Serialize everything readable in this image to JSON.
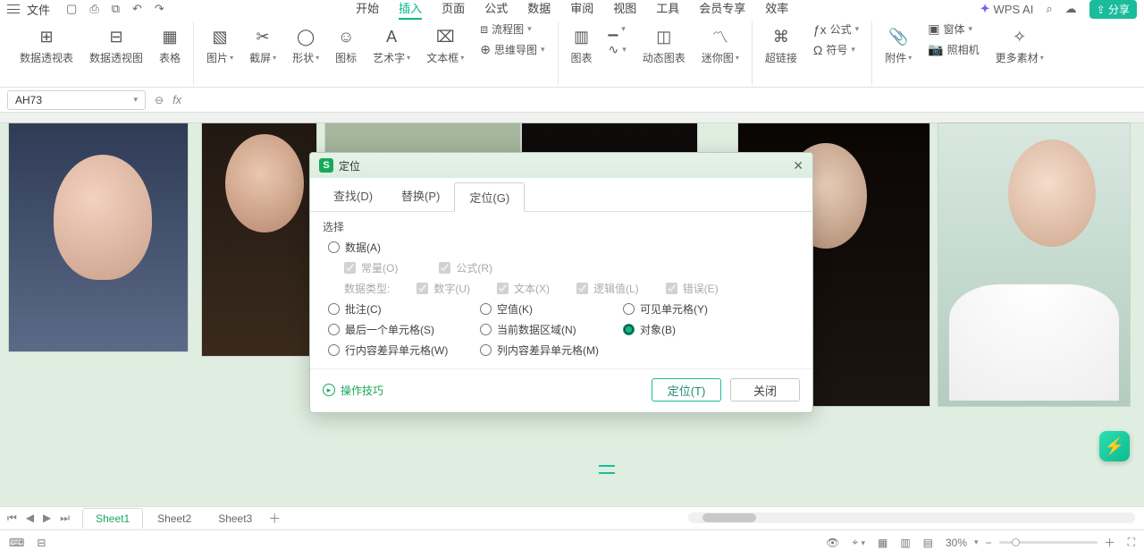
{
  "menubar": {
    "file": "文件",
    "tabs": [
      "开始",
      "插入",
      "页面",
      "公式",
      "数据",
      "审阅",
      "视图",
      "工具",
      "会员专享",
      "效率"
    ],
    "active_tab": 1,
    "ai": "WPS AI",
    "share": "分享"
  },
  "ribbon": {
    "g1": {
      "pivot_table": "数据透视表",
      "pivot_chart": "数据透视图",
      "table": "表格"
    },
    "g2": {
      "picture": "图片",
      "screenshot": "截屏",
      "shape": "形状",
      "icon": "图标",
      "wordart": "艺术字",
      "textbox": "文本框",
      "flow": "流程图",
      "mind": "思维导图"
    },
    "g3": {
      "chart": "图表",
      "spark": "迷你图",
      "dyn": "动态图表"
    },
    "g4": {
      "link": "超链接",
      "formula": "公式",
      "symbol": "符号"
    },
    "g5": {
      "attach": "附件",
      "camera": "照相机",
      "window": "窗体",
      "more": "更多素材"
    }
  },
  "namebox": "AH73",
  "dialog": {
    "title": "定位",
    "tabs": [
      "查找(D)",
      "替换(P)",
      "定位(G)"
    ],
    "active_tab": 2,
    "section": "选择",
    "data": "数据(A)",
    "const": "常量(O)",
    "formula": "公式(R)",
    "dtype": "数据类型:",
    "num": "数字(U)",
    "text": "文本(X)",
    "logic": "逻辑值(L)",
    "err": "错误(E)",
    "comment": "批注(C)",
    "blank": "空值(K)",
    "visible": "可见单元格(Y)",
    "last": "最后一个单元格(S)",
    "region": "当前数据区域(N)",
    "object": "对象(B)",
    "rowdiff": "行内容差异单元格(W)",
    "coldiff": "列内容差异单元格(M)",
    "tips": "操作技巧",
    "btn_go": "定位(T)",
    "btn_close": "关闭"
  },
  "sheets": [
    "Sheet1",
    "Sheet2",
    "Sheet3"
  ],
  "active_sheet": 0,
  "status": {
    "zoom": "30%"
  }
}
